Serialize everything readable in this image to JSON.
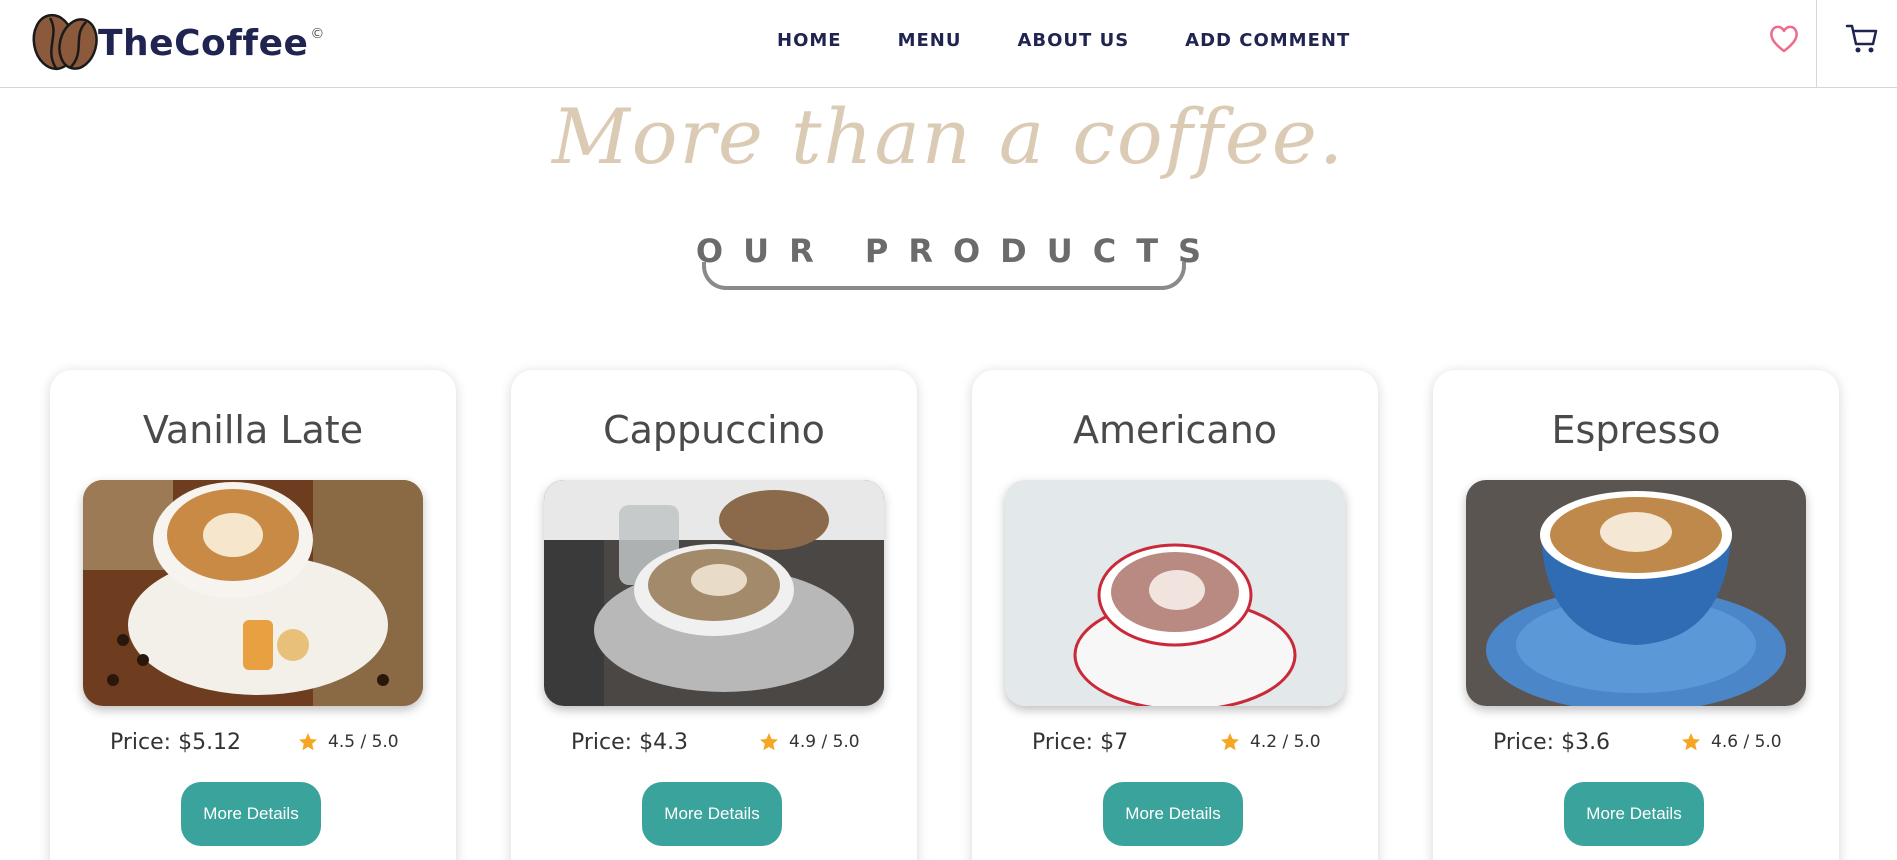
{
  "header": {
    "logo_text": "TheCoffee",
    "logo_mark": "©",
    "nav": [
      "HOME",
      "MENU",
      "ABOUT US",
      "ADD COMMENT"
    ],
    "icons": [
      "coffee-bean-logo-icon",
      "heart-icon",
      "cart-icon"
    ]
  },
  "hero": {
    "tagline": "More than a coffee.",
    "section_title": "OUR PRODUCTS"
  },
  "products": [
    {
      "name": "Vanilla Late",
      "price": "Price: $5.12",
      "rating": "4.5 / 5.0",
      "button": "More Details"
    },
    {
      "name": "Cappuccino",
      "price": "Price: $4.3",
      "rating": "4.9 / 5.0",
      "button": "More Details"
    },
    {
      "name": "Americano",
      "price": "Price: $7",
      "rating": "4.2 / 5.0",
      "button": "More Details"
    },
    {
      "name": "Espresso",
      "price": "Price: $3.6",
      "rating": "4.6 / 5.0",
      "button": "More Details"
    }
  ],
  "colors": {
    "brand_navy": "#1f2450",
    "tagline": "#dccbb4",
    "button_teal": "#3aa39c",
    "heart_pink": "#f06b8a",
    "star_gold": "#f5a623"
  }
}
